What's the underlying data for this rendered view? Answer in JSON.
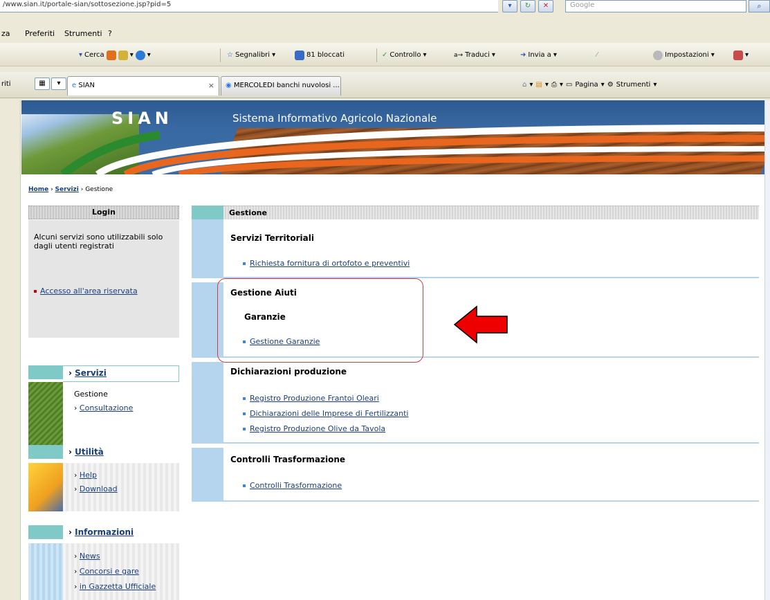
{
  "browser": {
    "url": "/www.sian.it/portale-sian/sottosezione.jsp?pid=5",
    "search_placeholder": "Google",
    "menu": [
      "za",
      "Preferiti",
      "Strumenti",
      "?"
    ],
    "toolbar": {
      "search": "Cerca",
      "bookmarks": "Segnalibri",
      "blocked": "81 bloccati",
      "check": "Controllo",
      "translate": "Traduci",
      "send": "Invia a",
      "settings": "Impostazioni"
    },
    "left_stub": "riti",
    "tabs": [
      {
        "label": "SIAN",
        "active": true
      },
      {
        "label": "MERCOLEDI banchi nuvolosi ...",
        "active": false
      }
    ],
    "tab_tools": {
      "page": "Pagina",
      "tools": "Strumenti"
    }
  },
  "banner": {
    "title": "SIAN",
    "subtitle": "Sistema Informativo Agricolo Nazionale"
  },
  "breadcrumb": {
    "home": "Home",
    "servizi": "Servizi",
    "current": "Gestione"
  },
  "login": {
    "heading": "Login",
    "text": "Alcuni servizi sono utilizzabili solo dagli utenti registrati",
    "link": "Accesso all'area riservata"
  },
  "nav": {
    "servizi": {
      "title": "Servizi",
      "items": [
        "Gestione",
        "Consultazione"
      ]
    },
    "utilita": {
      "title": "Utilità",
      "items": [
        "Help",
        "Download"
      ]
    },
    "informazioni": {
      "title": "Informazioni",
      "items": [
        "News",
        "Concorsi e gare",
        "in Gazzetta Ufficiale"
      ]
    }
  },
  "main": {
    "header": "Gestione",
    "sections": [
      {
        "title": "Servizi Territoriali",
        "links": [
          "Richiesta fornitura di ortofoto e preventivi"
        ]
      },
      {
        "title": "Gestione Aiuti",
        "subtitle": "Garanzie",
        "links": [
          "Gestione Garanzie"
        ]
      },
      {
        "title": "Dichiarazioni produzione",
        "links": [
          "Registro Produzione Frantoi Oleari",
          "Dichiarazioni delle Imprese di Fertilizzanti",
          "Registro Produzione Olive da Tavola"
        ]
      },
      {
        "title": "Controlli Trasformazione",
        "links": [
          "Controlli Trasformazione"
        ]
      }
    ]
  },
  "colors": {
    "link": "#1a3e7c",
    "annotation": "#d43a3a",
    "arrow_fill": "#ee0000",
    "accent_teal": "#7fc9c6",
    "strip_blue": "#b5d5ef"
  }
}
